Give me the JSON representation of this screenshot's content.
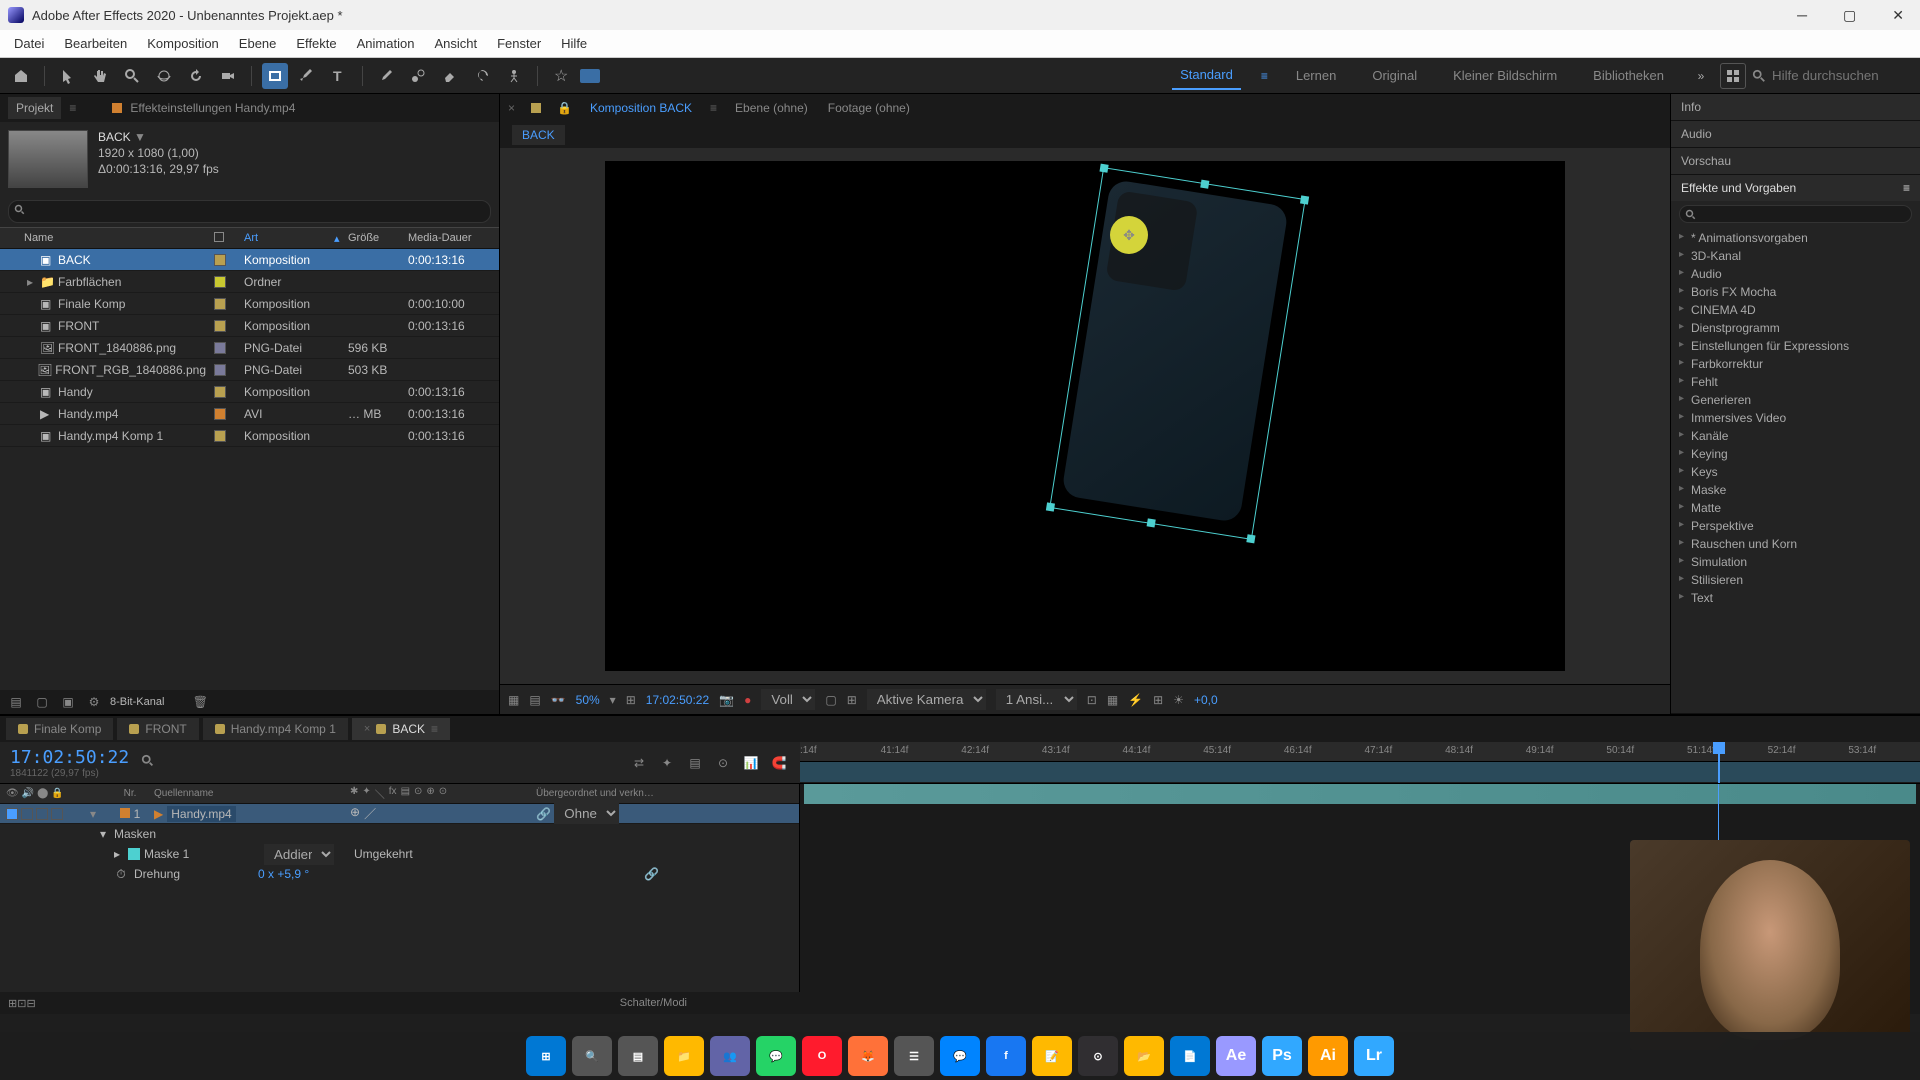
{
  "app": {
    "title": "Adobe After Effects 2020 - Unbenanntes Projekt.aep *"
  },
  "menu": [
    "Datei",
    "Bearbeiten",
    "Komposition",
    "Ebene",
    "Effekte",
    "Animation",
    "Ansicht",
    "Fenster",
    "Hilfe"
  ],
  "workspaces": {
    "items": [
      "Standard",
      "Lernen",
      "Original",
      "Kleiner Bildschirm",
      "Bibliotheken"
    ],
    "active": "Standard"
  },
  "search_placeholder": "Hilfe durchsuchen",
  "project": {
    "tab": "Projekt",
    "subtab": "Effekteinstellungen  Handy.mp4",
    "name": "BACK",
    "dims": "1920 x 1080 (1,00)",
    "duration": "Δ0:00:13:16, 29,97 fps",
    "columns": {
      "name": "Name",
      "type": "Art",
      "size": "Größe",
      "duration": "Media-Dauer"
    },
    "rows": [
      {
        "name": "BACK",
        "type": "Komposition",
        "size": "",
        "duration": "0:00:13:16",
        "label": "#b8a050",
        "icon": "comp",
        "selected": true
      },
      {
        "name": "Farbflächen",
        "type": "Ordner",
        "size": "",
        "duration": "",
        "label": "#c8c830",
        "icon": "folder"
      },
      {
        "name": "Finale Komp",
        "type": "Komposition",
        "size": "",
        "duration": "0:00:10:00",
        "label": "#b8a050",
        "icon": "comp"
      },
      {
        "name": "FRONT",
        "type": "Komposition",
        "size": "",
        "duration": "0:00:13:16",
        "label": "#b8a050",
        "icon": "comp"
      },
      {
        "name": "FRONT_1840886.png",
        "type": "PNG-Datei",
        "size": "596 KB",
        "duration": "",
        "label": "#7a7a9a",
        "icon": "img"
      },
      {
        "name": "FRONT_RGB_1840886.png",
        "type": "PNG-Datei",
        "size": "503 KB",
        "duration": "",
        "label": "#7a7a9a",
        "icon": "img"
      },
      {
        "name": "Handy",
        "type": "Komposition",
        "size": "",
        "duration": "0:00:13:16",
        "label": "#b8a050",
        "icon": "comp"
      },
      {
        "name": "Handy.mp4",
        "type": "AVI",
        "size": "… MB",
        "duration": "0:00:13:16",
        "label": "#d08030",
        "icon": "video"
      },
      {
        "name": "Handy.mp4 Komp 1",
        "type": "Komposition",
        "size": "",
        "duration": "0:00:13:16",
        "label": "#b8a050",
        "icon": "comp"
      }
    ],
    "bitdepth": "8-Bit-Kanal"
  },
  "composition": {
    "tabs": [
      {
        "label": "Komposition",
        "name": "BACK",
        "active": true
      },
      {
        "label": "Ebene  (ohne)"
      },
      {
        "label": "Footage  (ohne)"
      }
    ],
    "breadcrumb": "BACK",
    "footer": {
      "zoom": "50%",
      "time": "17:02:50:22",
      "res": "Voll",
      "camera": "Aktive Kamera",
      "views": "1 Ansi...",
      "exposure": "+0,0"
    }
  },
  "right": {
    "info": "Info",
    "audio": "Audio",
    "preview": "Vorschau",
    "effects": "Effekte und Vorgaben",
    "categories": [
      "* Animationsvorgaben",
      "3D-Kanal",
      "Audio",
      "Boris FX Mocha",
      "CINEMA 4D",
      "Dienstprogramm",
      "Einstellungen für Expressions",
      "Farbkorrektur",
      "Fehlt",
      "Generieren",
      "Immersives Video",
      "Kanäle",
      "Keying",
      "Keys",
      "Maske",
      "Matte",
      "Perspektive",
      "Rauschen und Korn",
      "Simulation",
      "Stilisieren",
      "Text"
    ]
  },
  "timeline": {
    "tabs": [
      {
        "label": "Finale Komp",
        "color": "#b8a050"
      },
      {
        "label": "FRONT",
        "color": "#b8a050"
      },
      {
        "label": "Handy.mp4 Komp 1",
        "color": "#b8a050"
      },
      {
        "label": "BACK",
        "color": "#b8a050",
        "active": true
      }
    ],
    "time": "17:02:50:22",
    "frames_label": "1841122 (29,97 fps)",
    "col_nr": "Nr.",
    "col_name": "Quellenname",
    "col_parent": "Übergeordnet und verkn…",
    "ticks": [
      ":14f",
      "41:14f",
      "42:14f",
      "43:14f",
      "44:14f",
      "45:14f",
      "46:14f",
      "47:14f",
      "48:14f",
      "49:14f",
      "50:14f",
      "51:14f",
      "52:14f",
      "53:14f"
    ],
    "layer": {
      "nr": "1",
      "name": "Handy.mp4",
      "parent": "Ohne"
    },
    "mask_group": "Masken",
    "mask": {
      "name": "Maske 1",
      "mode": "Addiere…",
      "inv": "Umgekehrt"
    },
    "rotation": {
      "label": "Drehung",
      "value": "0 x +5,9 °"
    },
    "footer": "Schalter/Modi"
  },
  "taskbar_icons": [
    "win",
    "search",
    "tasks",
    "explorer",
    "teams",
    "whatsapp",
    "opera",
    "firefox",
    "app1",
    "messenger",
    "facebook",
    "notes",
    "obs",
    "folder",
    "notepad",
    "ae",
    "ps",
    "ai",
    "lr"
  ]
}
